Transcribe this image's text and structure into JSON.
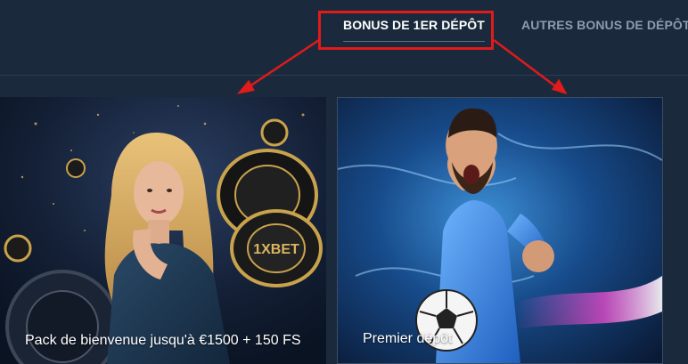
{
  "tabs": {
    "first_deposit": "BONUS DE 1ER DÉPÔT",
    "other_deposit": "AUTRES BONUS DE DÉPÔT"
  },
  "cards": [
    {
      "caption": "Pack de bienvenue jusqu'à €1500 + 150 FS",
      "image": "casino-hostess-image"
    },
    {
      "caption": "Premier dépôt",
      "image": "football-player-image"
    }
  ],
  "casino_chip_logo": "1XBET",
  "colors": {
    "background": "#1a2a3c",
    "annotation_red": "#e11a1a",
    "tab_active": "#ffffff",
    "tab_inactive": "#8c9bb0"
  }
}
